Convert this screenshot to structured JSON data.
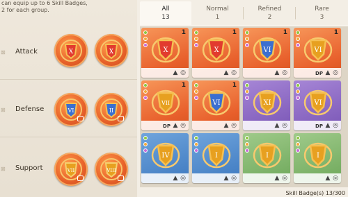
{
  "hint": {
    "line1": "can equip up to 6 Skill Badges,",
    "line2": "2 for each group."
  },
  "groups": [
    {
      "label": "Attack"
    },
    {
      "label": "Defense"
    },
    {
      "label": "Support"
    }
  ],
  "tabs": [
    {
      "label": "All",
      "count": "13",
      "active": true
    },
    {
      "label": "Normal",
      "count": "1",
      "active": false
    },
    {
      "label": "Refined",
      "count": "2",
      "active": false
    },
    {
      "label": "Rare",
      "count": "3",
      "active": false
    }
  ],
  "cards": [
    {
      "color": "orange",
      "count": "1",
      "numeral": "X",
      "shield": "#e23b2e",
      "dp": ""
    },
    {
      "color": "orange",
      "count": "1",
      "numeral": "X",
      "shield": "#e23b2e",
      "dp": ""
    },
    {
      "color": "orange",
      "count": "1",
      "numeral": "VI",
      "shield": "#3b6fd0",
      "dp": ""
    },
    {
      "color": "orange",
      "count": "1",
      "numeral": "VI",
      "shield": "#e7a020",
      "dp": "DP"
    },
    {
      "color": "orange",
      "count": "1",
      "numeral": "VII",
      "shield": "#e7a020",
      "dp": "DP"
    },
    {
      "color": "orange",
      "count": "1",
      "numeral": "VI",
      "shield": "#3b6fd0",
      "dp": ""
    },
    {
      "color": "purple",
      "count": "",
      "numeral": "XI",
      "shield": "#e7a020",
      "dp": ""
    },
    {
      "color": "purple",
      "count": "",
      "numeral": "VI",
      "shield": "#e7a020",
      "dp": "DP"
    },
    {
      "color": "blue",
      "count": "",
      "numeral": "IV",
      "shield": "#e7a020",
      "dp": ""
    },
    {
      "color": "blue",
      "count": "",
      "numeral": "I",
      "shield": "#e7a020",
      "dp": ""
    },
    {
      "color": "green",
      "count": "",
      "numeral": "I",
      "shield": "#e7a020",
      "dp": ""
    },
    {
      "color": "green",
      "count": "",
      "numeral": "I",
      "shield": "#e7a020",
      "dp": ""
    }
  ],
  "footer": {
    "label": "Skill Badge(s)",
    "value": "13/300"
  },
  "colors": {
    "accent_orange": "#e8602c",
    "rare_blue": "#3d79c0",
    "epic_purple": "#7a56b6",
    "green": "#6ea85a"
  }
}
